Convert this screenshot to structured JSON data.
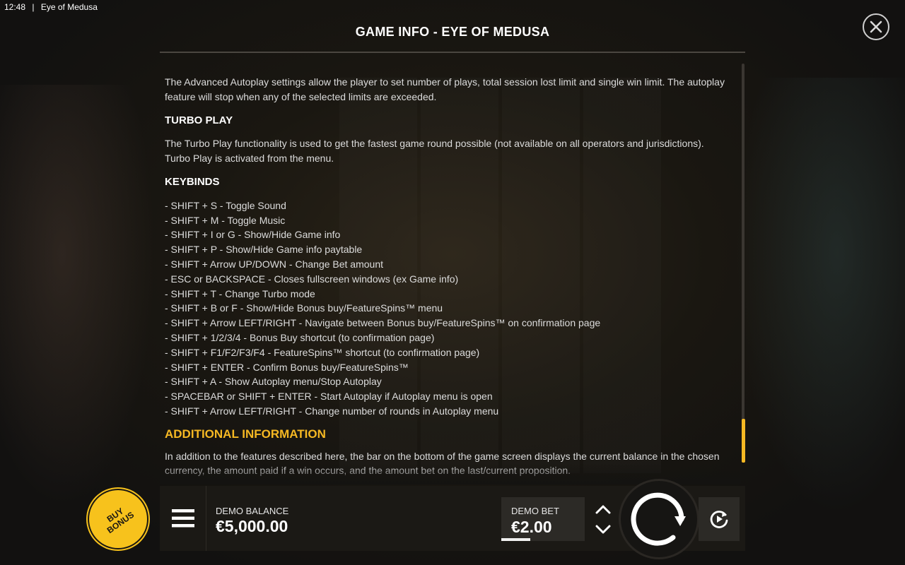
{
  "status_bar": {
    "time": "12:48",
    "separator": "|",
    "app_title": "Eye of Medusa"
  },
  "dialog": {
    "title": "GAME INFO - EYE OF MEDUSA",
    "close_icon": "close-circle-icon"
  },
  "content": {
    "autoplay_paragraph": "The Advanced Autoplay settings allow the player to set number of plays, total session lost limit and single win limit. The autoplay feature will stop when any of the selected limits are exceeded.",
    "turbo_heading": "TURBO PLAY",
    "turbo_paragraph": "The Turbo Play functionality is used to get the fastest game round possible (not available on all operators and jurisdictions). Turbo Play is activated from the menu.",
    "keybinds_heading": "KEYBINDS",
    "keybinds": [
      "- SHIFT + S - Toggle Sound",
      "- SHIFT + M - Toggle Music",
      "- SHIFT + I or G - Show/Hide Game info",
      "- SHIFT + P - Show/Hide Game info paytable",
      "- SHIFT + Arrow UP/DOWN - Change Bet amount",
      "- ESC or BACKSPACE - Closes fullscreen windows (ex Game info)",
      "- SHIFT + T - Change Turbo mode",
      "- SHIFT + B or F - Show/Hide Bonus buy/FeatureSpins™ menu",
      "- SHIFT + Arrow LEFT/RIGHT - Navigate between Bonus buy/FeatureSpins™ on confirmation page",
      "- SHIFT + 1/2/3/4 - Bonus Buy shortcut (to confirmation page)",
      "- SHIFT + F1/F2/F3/F4 - FeatureSpins™ shortcut (to confirmation page)",
      "- SHIFT + ENTER - Confirm Bonus buy/FeatureSpins™",
      "- SHIFT + A - Show Autoplay menu/Stop Autoplay",
      "- SPACEBAR or SHIFT + ENTER - Start Autoplay if Autoplay menu is open",
      "- SHIFT + Arrow LEFT/RIGHT - Change number of rounds in Autoplay menu"
    ],
    "additional_heading": "ADDITIONAL INFORMATION",
    "additional_paragraph": "In addition to the features described here, the bar on the bottom of the game screen displays the current balance in the chosen currency, the amount paid if a win occurs, and the amount bet on the last/current proposition."
  },
  "bottom_bar": {
    "buy_bonus_label": "BUY BONUS",
    "balance_label": "DEMO BALANCE",
    "balance_value": "€5,000.00",
    "bet_label": "DEMO BET",
    "bet_value": "€2.00",
    "bet_level_fraction": 0.35,
    "icons": {
      "menu": "hamburger-menu-icon",
      "bet_up": "chevron-up-icon",
      "bet_down": "chevron-down-icon",
      "spin": "spin-arrow-icon",
      "autoplay": "autoplay-icon"
    }
  },
  "colors": {
    "accent": "#f5b823",
    "buy_bonus": "#f7c21c",
    "background": "#1a1711"
  }
}
